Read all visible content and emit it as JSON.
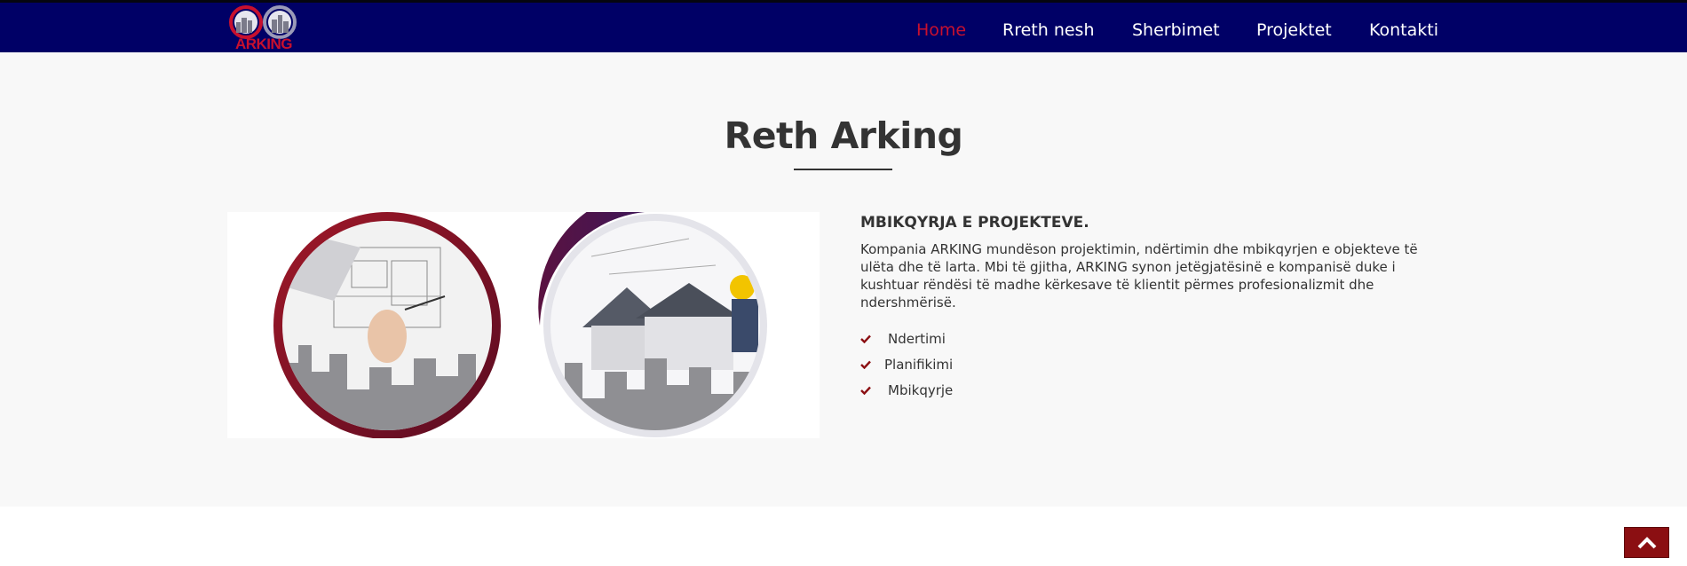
{
  "header": {
    "logo_text": "ARKING",
    "nav": [
      {
        "label": "Home",
        "active": true
      },
      {
        "label": "Rreth nesh",
        "active": false
      },
      {
        "label": "Sherbimet",
        "active": false
      },
      {
        "label": "Projektet",
        "active": false
      },
      {
        "label": "Kontakti",
        "active": false
      }
    ]
  },
  "about": {
    "title": "Reth Arking",
    "heading": "MBIKQYRJA E PROJEKTEVE.",
    "paragraph": "Kompania ARKING mundëson projektimin, ndërtimin dhe mbikqyrjen e objekteve të ulëta dhe të larta. Mbi të gjitha, ARKING synon jetëgjatësinë e kompanisë duke i kushtuar rëndësi të madhe kërkesave të klientit përmes profesionalizmit dhe ndershmërisë.",
    "features": [
      {
        "label": "Ndertimi"
      },
      {
        "label": "Planifikimi"
      },
      {
        "label": "Mbikqyrje"
      }
    ]
  },
  "icons": {
    "feature": "check-icon",
    "back_to_top": "chevron-up-icon"
  },
  "colors": {
    "navbar": "#000066",
    "accent_red": "#c8102e",
    "button_red": "#8b0f12",
    "section_bg": "#f8f8f8",
    "text": "#333333"
  }
}
